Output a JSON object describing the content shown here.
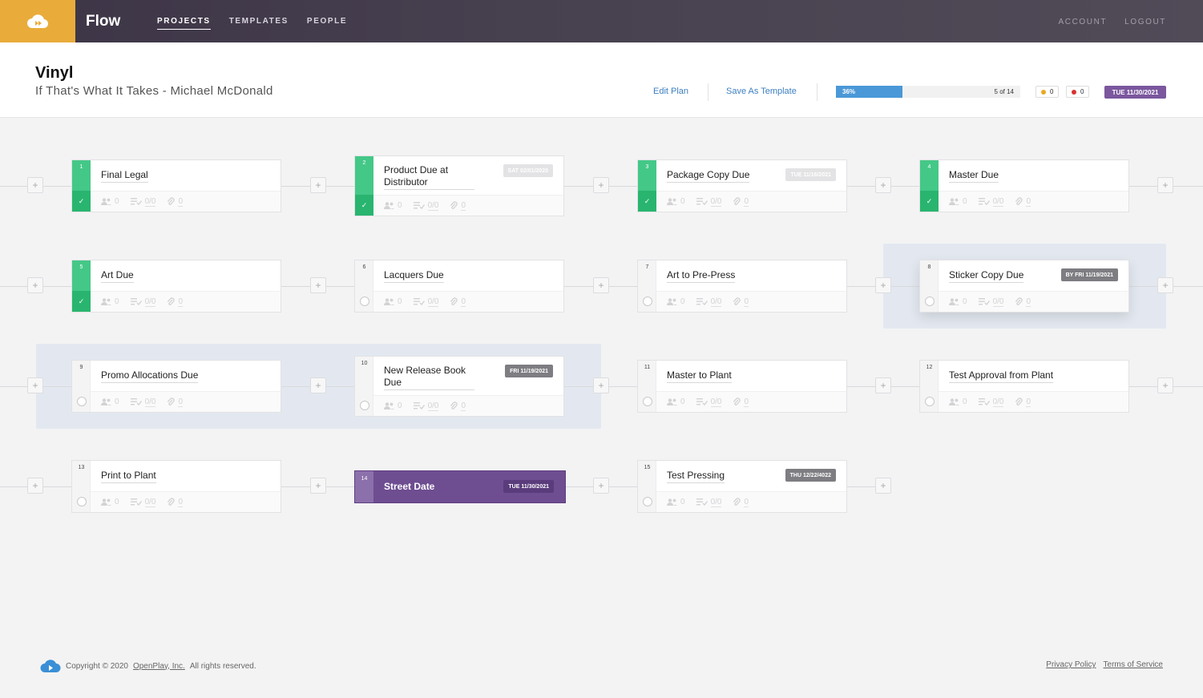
{
  "nav": {
    "brand": "Flow",
    "links": [
      "PROJECTS",
      "TEMPLATES",
      "PEOPLE"
    ],
    "right": [
      "ACCOUNT",
      "LOGOUT"
    ],
    "colors": {
      "logo_bg": "#e9ac3b",
      "bar": "#3d3547"
    }
  },
  "header": {
    "title": "Vinyl",
    "subtitle": "If That's What It Takes - Michael McDonald",
    "edit_plan": "Edit Plan",
    "save_template": "Save As Template",
    "progress": {
      "percent_label": "36%",
      "fraction": 0.36,
      "count_label": "5 of 14"
    },
    "warnings_count": "0",
    "errors_count": "0",
    "due_date": "TUE 11/30/2021"
  },
  "tasks": [
    {
      "num": "1",
      "title": "Final Legal",
      "done": true,
      "people": "0",
      "checks": "0/0",
      "files": "0"
    },
    {
      "num": "2",
      "title": "Product Due at",
      "title2": "Distributor",
      "done": true,
      "date": "SAT 02/01/2020",
      "people": "0",
      "checks": "0/0",
      "files": "0"
    },
    {
      "num": "3",
      "title": "Package Copy Due",
      "done": true,
      "date": "TUE 11/16/2021",
      "people": "0",
      "checks": "0/0",
      "files": "0"
    },
    {
      "num": "4",
      "title": "Master Due",
      "done": true,
      "people": "0",
      "checks": "0/0",
      "files": "0"
    },
    {
      "num": "5",
      "title": "Art Due",
      "done": true,
      "people": "0",
      "checks": "0/0",
      "files": "0"
    },
    {
      "num": "6",
      "title": "Lacquers Due",
      "done": false,
      "people": "0",
      "checks": "0/0",
      "files": "0"
    },
    {
      "num": "7",
      "title": "Art to Pre-Press",
      "done": false,
      "people": "0",
      "checks": "0/0",
      "files": "0"
    },
    {
      "num": "8",
      "title": "Sticker Copy Due",
      "done": false,
      "date": "BY FRI 11/19/2021",
      "people": "0",
      "checks": "0/0",
      "files": "0"
    },
    {
      "num": "9",
      "title": "Promo Allocations Due",
      "done": false,
      "people": "0",
      "checks": "0/0",
      "files": "0"
    },
    {
      "num": "10",
      "title": "New Release Book",
      "title2": "Due",
      "done": false,
      "date": "FRI 11/19/2021",
      "people": "0",
      "checks": "0/0",
      "files": "0"
    },
    {
      "num": "11",
      "title": "Master to Plant",
      "done": false,
      "people": "0",
      "checks": "0/0",
      "files": "0"
    },
    {
      "num": "12",
      "title": "Test Approval from Plant",
      "done": false,
      "people": "0",
      "checks": "0/0",
      "files": "0"
    },
    {
      "num": "13",
      "title": "Print to Plant",
      "done": false,
      "people": "0",
      "checks": "0/0",
      "files": "0"
    },
    {
      "num": "14",
      "title": "Street Date",
      "date": "TUE 11/30/2021"
    },
    {
      "num": "15",
      "title": "Test Pressing",
      "done": false,
      "date": "THU 12/22/4022",
      "people": "0",
      "checks": "0/0",
      "files": "0"
    }
  ],
  "footer": {
    "copyright_prefix": "Copyright © 2020",
    "company": "OpenPlay, Inc.",
    "rights": "All rights reserved.",
    "privacy": "Privacy Policy",
    "terms": "Terms of Service"
  },
  "plus_symbol": "+"
}
